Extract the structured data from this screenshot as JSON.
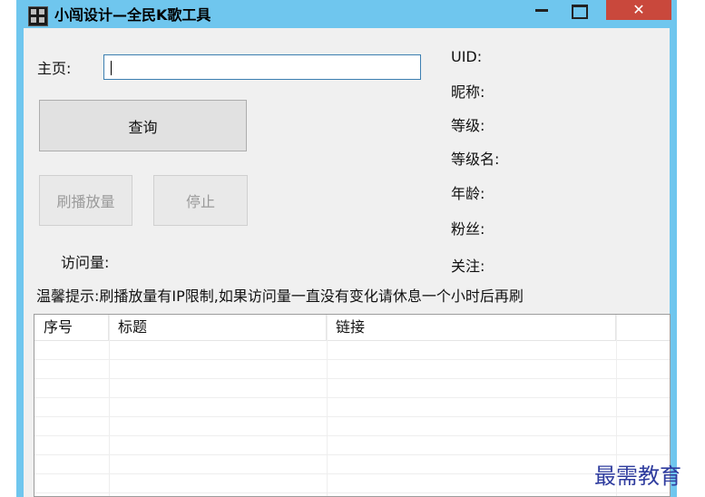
{
  "window": {
    "title": "小闯设计—全民K歌工具",
    "minimize_glyph": "−",
    "maximize_glyph": "□",
    "close_glyph": "✕"
  },
  "form": {
    "homepage_label": "主页:",
    "homepage_value": "",
    "query_button": "查询",
    "brush_button": "刷播放量",
    "stop_button": "停止",
    "visits_label": "访问量:",
    "tip": "温馨提示:刷播放量有IP限制,如果访问量一直没有变化请休息一个小时后再刷"
  },
  "info": {
    "uid_label": "UID:",
    "nickname_label": "昵称:",
    "level_label": "等级:",
    "level_name_label": "等级名:",
    "age_label": "年龄:",
    "fans_label": "粉丝:",
    "follow_label": "关注:"
  },
  "table": {
    "columns": [
      "序号",
      "标题",
      "链接",
      ""
    ]
  },
  "watermark": "最需教育",
  "colors": {
    "title_bar": "#6fc6ee",
    "close_button": "#c9483c",
    "client_bg": "#f0f0f0",
    "input_border": "#3c7fb1",
    "watermark": "#2f3c9e"
  }
}
